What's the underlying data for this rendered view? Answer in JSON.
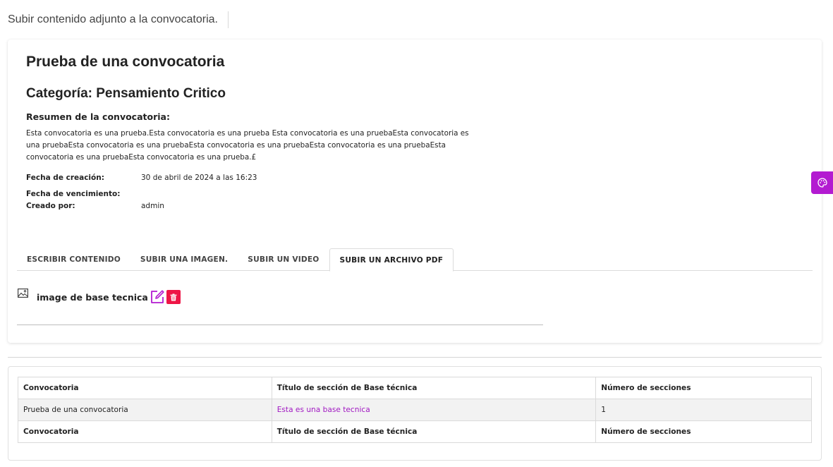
{
  "header": {
    "title": "Subir contenido adjunto a la convocatoria."
  },
  "convocatoria": {
    "title": "Prueba de una convocatoria",
    "category": "Categoría: Pensamiento Critico",
    "summary_label": "Resumen de la convocatoria:",
    "summary_text": "Esta convocatoria es una prueba.Esta convocatoria es una prueba Esta convocatoria es una pruebaEsta convocatoria es una pruebaEsta convocatoria es una pruebaEsta convocatoria es una pruebaEsta convocatoria es una pruebaEsta convocatoria es una pruebaEsta convocatoria es una prueba.£",
    "created_label": "Fecha de creación:",
    "created_value": "30 de abril de 2024 a las 16:23",
    "due_label": "Fecha de vencimiento:",
    "due_value": "",
    "author_label": "Creado por:",
    "author_value": "admin"
  },
  "tabs": [
    {
      "label": "ESCRIBIR CONTENIDO"
    },
    {
      "label": "SUBIR UNA IMAGEN."
    },
    {
      "label": "SUBIR UN VIDEO"
    },
    {
      "label": "SUBIR UN ARCHIVO PDF",
      "active": true
    }
  ],
  "attachment": {
    "name": "image de base tecnica",
    "icon": "image-icon",
    "edit_icon": "edit-icon",
    "delete_icon": "trash-icon"
  },
  "table": {
    "headers": [
      "Convocatoria",
      "Título de sección de Base técnica",
      "Número de secciones"
    ],
    "rows": [
      [
        "Prueba de una convocatoria",
        "Esta es una base tecnica",
        "1"
      ]
    ],
    "footers": [
      "Convocatoria",
      "Título de sección de Base técnica",
      "Número de secciones"
    ]
  },
  "floating_button": {
    "icon": "palette-icon"
  },
  "colors": {
    "accent": "#a119c2",
    "floating": "#b31bd1",
    "danger": "#ee1546"
  }
}
